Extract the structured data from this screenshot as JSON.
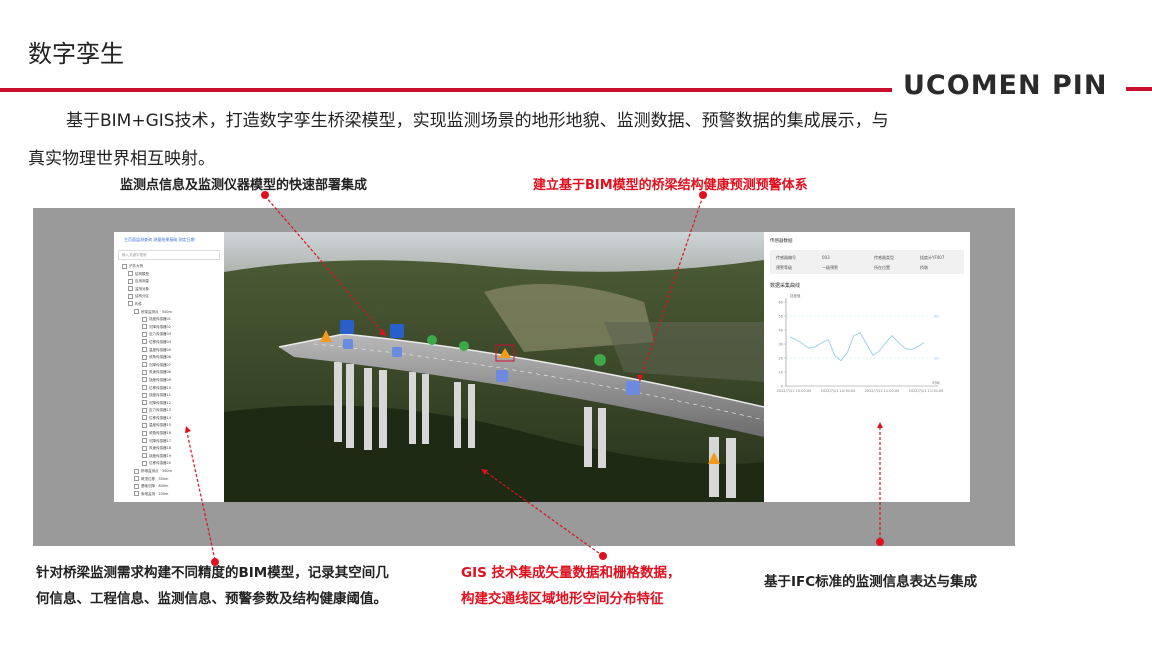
{
  "header": {
    "title": "数字孪生",
    "brand": "UCOMEN PIN"
  },
  "intro": {
    "line1": "基于BIM+GIS技术，打造数字孪生桥梁模型，实现监测场景的地形地貌、监测数据、预警数据的集成展示，与",
    "line2": "真实物理世界相互映射。"
  },
  "callouts": {
    "top_left": "监测点信息及监测仪器模型的快速部署集成",
    "top_right": "建立基于BIM模型的桥梁结构健康预测预警体系",
    "bottom_left_line1": "针对桥梁监测需求构建不同精度的BIM模型，记录其空间几",
    "bottom_left_line2": "何信息、工程信息、监测信息、预警参数及结构健康阈值。",
    "bottom_mid_line1": "GIS 技术集成矢量数据和栅格数据，",
    "bottom_mid_line2": "构建交通线区域地形空间分布特征",
    "bottom_right": "基于IFC标准的监测信息表达与集成"
  },
  "colors": {
    "accent_red": "#c8102e",
    "callout_red": "#e0101e",
    "frame_gray": "#9a9a9a",
    "chart_line": "#9fd3e4"
  },
  "tree_panel": {
    "tabs": "主页面监测查询   测量结果基础   测定日期",
    "search_placeholder": "输入关键字搜索",
    "items": [
      "沪苏大桥",
      "结构模型",
      "应用测量",
      "监测对象",
      "结构分区",
      "构件",
      "桥梁监测点 · 500m",
      "挠度传感器01",
      "沉降传感器02",
      "应力传感器03",
      "位移传感器04",
      "温度传感器05",
      "倾角传感器06",
      "沉降传感器07",
      "风速传感器08",
      "挠度传感器09",
      "位移传感器10",
      "挠度传感器11",
      "沉降传感器12",
      "应力传感器13",
      "位移传感器14",
      "温度传感器15",
      "倾角传感器16",
      "沉降传感器17",
      "风速传感器18",
      "挠度传感器19",
      "位移传感器20",
      "桥墩监测点 · 300m",
      "墩顶位移 · 300m",
      "基础沉降 · 800m",
      "索塔监测 · 200m"
    ]
  },
  "info_panel": {
    "title": "传感器数据",
    "meta": [
      {
        "label": "传感器编号",
        "value": "003"
      },
      {
        "label": "传感器类型",
        "value": "挠度计YF007"
      },
      {
        "label": "预警等级",
        "value": "一级预警"
      },
      {
        "label": "所在位置",
        "value": "桥墩"
      }
    ],
    "chart_heading": "数据采集曲线"
  },
  "chart_data": {
    "type": "line",
    "title": "数据采集曲线",
    "ylabel": "挠度值",
    "ylim": [
      0,
      60
    ],
    "yticks": [
      "60",
      "50",
      "40",
      "30",
      "20",
      "10",
      "0"
    ],
    "xticks": [
      "2022/7/21 10:00:00",
      "2022/7/21 10:30:00",
      "2022/7/21 11:00:00",
      "2022/7/21 11:30:00"
    ],
    "xlabel": "时间",
    "threshold_labels": [
      "50",
      "20"
    ],
    "series": [
      {
        "values": [
          35,
          33,
          30,
          27,
          28,
          31,
          33,
          22,
          18,
          24,
          36,
          38,
          30,
          22,
          25,
          31,
          36,
          31,
          27,
          26,
          28,
          31
        ]
      }
    ]
  }
}
